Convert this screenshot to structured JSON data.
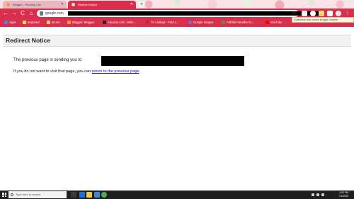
{
  "tabs": [
    {
      "title": "Blogger - Reading List",
      "active": false
    },
    {
      "title": "Redirect Notice",
      "active": true
    }
  ],
  "new_tab_label": "+",
  "toolbar": {
    "back": "←",
    "forward": "→",
    "reload": "C",
    "home": "⌂",
    "url": "google.com",
    "star": "☆"
  },
  "tooltip": "Customize and control Google Chrome",
  "bookmarks": [
    {
      "label": "Apps",
      "color": "#4285f4"
    },
    {
      "label": "Imported",
      "color": "#f7d774"
    },
    {
      "label": "att.net",
      "color": "#f7d774"
    },
    {
      "label": "Blogger: Blogger",
      "color": "#f29d38"
    },
    {
      "label": "Amazon.com: Onlin...",
      "color": "#222222"
    },
    {
      "label": "TV Listings - Find L...",
      "color": "#cc2244"
    },
    {
      "label": "Google Images",
      "color": "#4285f4"
    },
    {
      "label": "Arthritis Weather In...",
      "color": "#5a8f3c"
    },
    {
      "label": "YouTube",
      "color": "#ff0000"
    }
  ],
  "page": {
    "heading": "Redirect Notice",
    "message_prefix": "The previous page is sending you to",
    "message2_prefix": "If you do not want to visit that page, you can",
    "return_link": "return to the previous page",
    "message2_suffix": "."
  },
  "taskbar": {
    "search_placeholder": "Type here to search",
    "time": "4:02 PM",
    "date": "7/1/2020"
  },
  "colors": {
    "theme_red": "#d82f4c",
    "link": "#1a0dab"
  }
}
